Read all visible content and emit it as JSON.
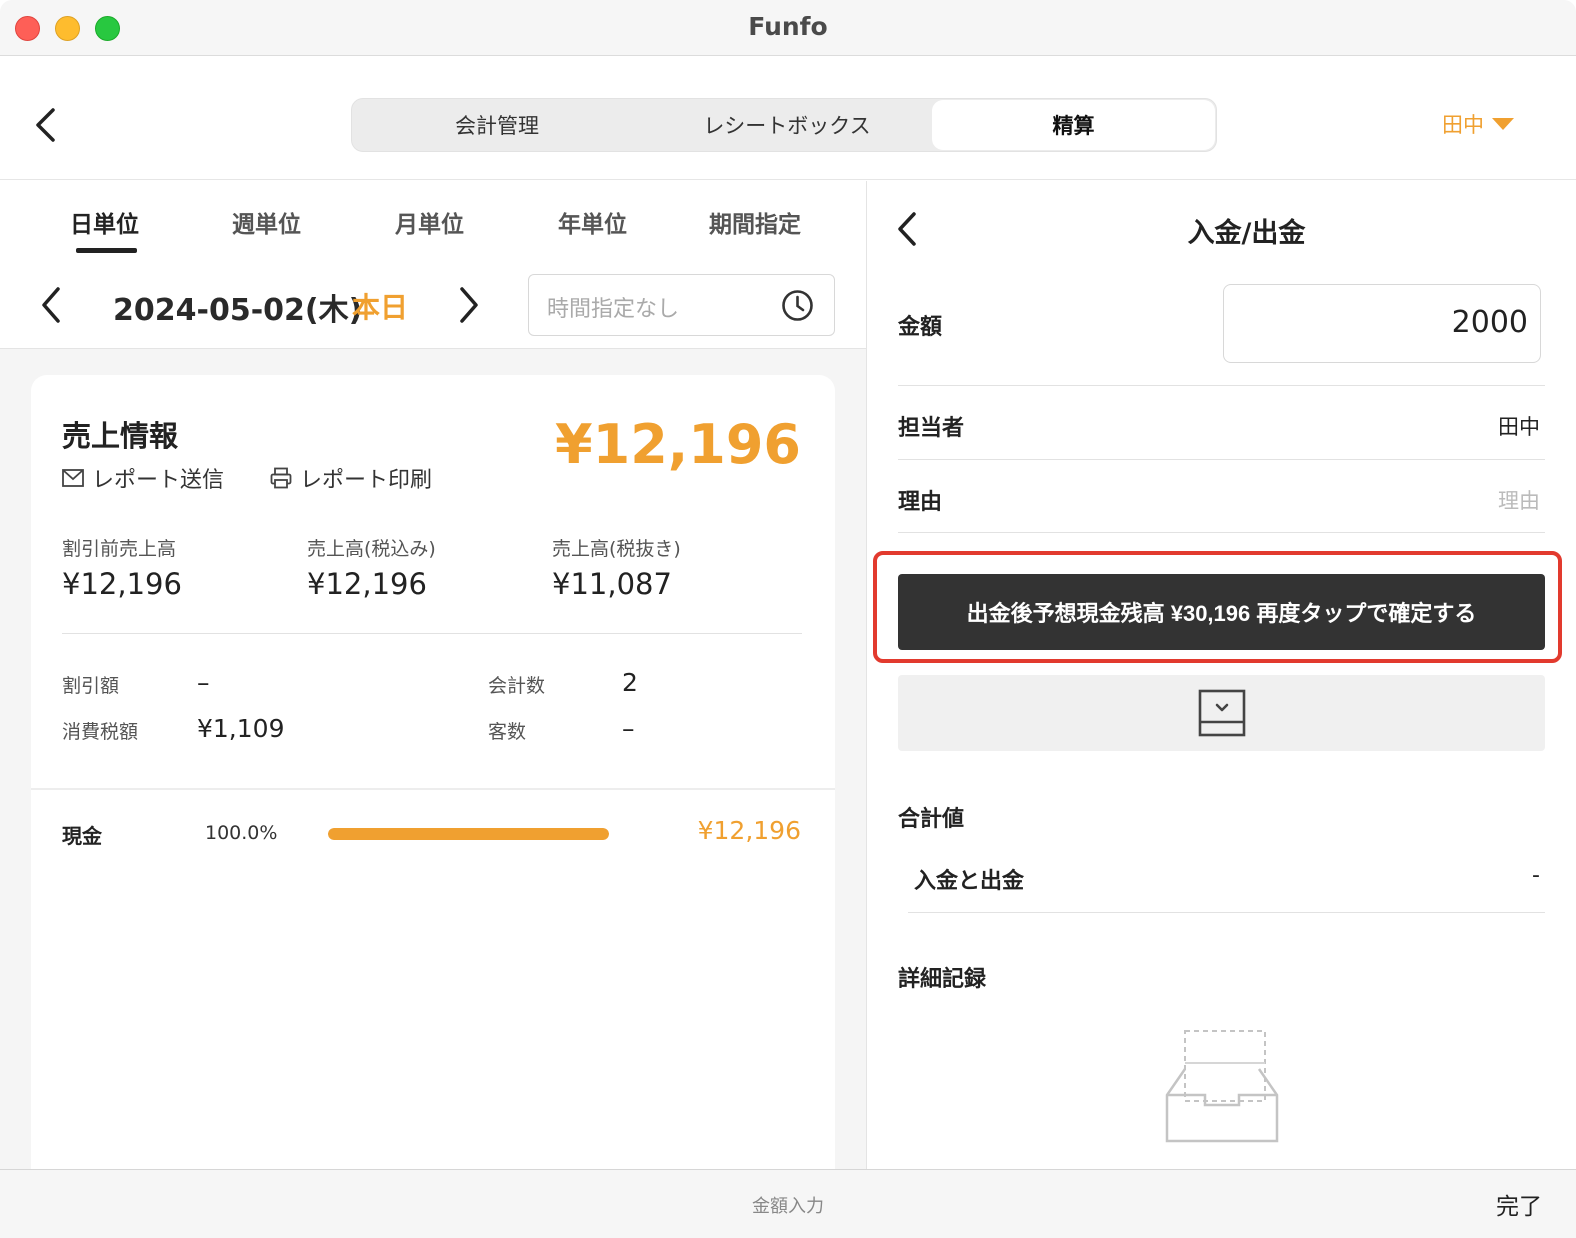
{
  "window": {
    "title": "Funfo"
  },
  "nav": {
    "tabs": [
      {
        "label": "会計管理",
        "active": false
      },
      {
        "label": "レシートボックス",
        "active": false
      },
      {
        "label": "精算",
        "active": true
      }
    ],
    "user": "田中"
  },
  "left": {
    "period_tabs": [
      "日単位",
      "週単位",
      "月単位",
      "年単位",
      "期間指定"
    ],
    "active_period": "日単位",
    "date": "2024-05-02(木)",
    "today_label": "本日",
    "time_placeholder": "時間指定なし",
    "sales": {
      "title": "売上情報",
      "total": "¥12,196",
      "send_report": "レポート送信",
      "print_report": "レポート印刷",
      "metrics": [
        {
          "label": "割引前売上高",
          "value": "¥12,196"
        },
        {
          "label": "売上高(税込み)",
          "value": "¥12,196"
        },
        {
          "label": "売上高(税抜き)",
          "value": "¥11,087"
        }
      ],
      "discount_label": "割引額",
      "discount_value": "–",
      "tax_label": "消費税額",
      "tax_value": "¥1,109",
      "checks_label": "会計数",
      "checks_value": "2",
      "guests_label": "客数",
      "guests_value": "–"
    },
    "payment": {
      "method": "現金",
      "percent": "100.0%",
      "fill_fraction": 1.0,
      "amount": "¥12,196"
    }
  },
  "right": {
    "title": "入金/出金",
    "amount_label": "金額",
    "amount_value": "2000",
    "staff_label": "担当者",
    "staff_value": "田中",
    "reason_label": "理由",
    "reason_placeholder": "理由",
    "confirm_button": "出金後予想現金残高 ¥30,196 再度タップで確定する",
    "totals_title": "合計値",
    "inout_label": "入金と出金",
    "inout_value": "-",
    "records_title": "詳細記録"
  },
  "bottom": {
    "title": "金額入力",
    "done": "完了"
  },
  "colors": {
    "accent": "#f0a030",
    "button_dark": "#333333",
    "highlight": "#e23a2e"
  }
}
